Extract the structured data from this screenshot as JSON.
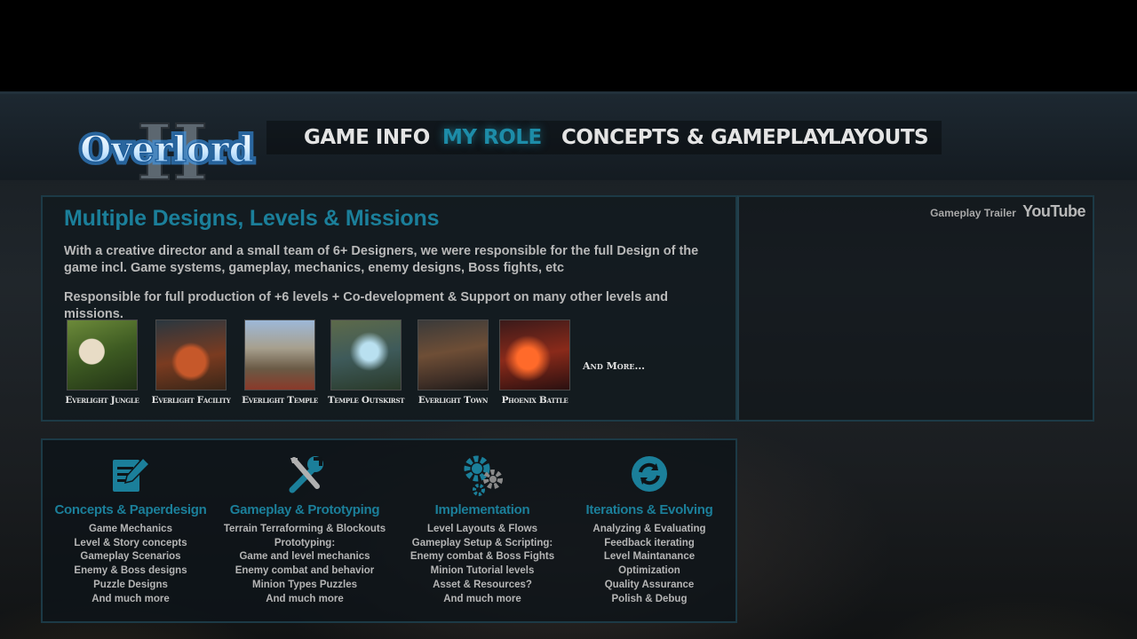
{
  "nav": {
    "items": [
      "GAME INFO",
      "MY ROLE",
      "CONCEPTS & GAMEPLAY",
      "LAYOUTS"
    ],
    "active": "MY ROLE"
  },
  "logo": {
    "text": "Overlord",
    "numeral": "II"
  },
  "main": {
    "title": "Multiple Designs, Levels & Missions",
    "paragraph1": "With a creative director and a small team of 6+ Designers, we were responsible for the full Design of the game incl. Game systems, gameplay, mechanics, enemy designs, Boss fights, etc",
    "paragraph2": "Responsible for full production of +6 levels + Co-development & Support on many other levels and missions.",
    "levels": [
      {
        "label": "Everlight Jungle"
      },
      {
        "label": "Everlight Facility"
      },
      {
        "label": "Everlight Temple"
      },
      {
        "label": "Temple Outskirst"
      },
      {
        "label": "Everlight Town"
      },
      {
        "label": "Phoenix Battle"
      }
    ],
    "and_more": "And More..."
  },
  "video": {
    "label": "Gameplay Trailer",
    "brand": "YouTube"
  },
  "roles": [
    {
      "icon": "document-edit-icon",
      "title": "Concepts & Paperdesign",
      "items": [
        "Game Mechanics",
        "Level & Story concepts",
        "Gameplay Scenarios",
        "Enemy & Boss designs",
        "Puzzle Designs",
        "And  much more"
      ]
    },
    {
      "icon": "tools-icon",
      "title": "Gameplay & Prototyping",
      "items": [
        "Terrain Terraforming & Blockouts",
        "Prototyping:",
        "Game and level mechanics",
        "Enemy combat and behavior",
        "Minion Types Puzzles",
        "And  much more"
      ]
    },
    {
      "icon": "gears-icon",
      "title": "Implementation",
      "items": [
        "Level Layouts & Flows",
        "Gameplay Setup & Scripting:",
        "Enemy combat & Boss Fights",
        "Minion Tutorial levels",
        "Asset & Resources?",
        "And  much more"
      ]
    },
    {
      "icon": "refresh-icon",
      "title": "Iterations & Evolving",
      "items": [
        "Analyzing & Evaluating",
        "Feedback iterating",
        "Level Maintanance",
        "Optimization",
        "Quality Assurance",
        "Polish & Debug"
      ]
    }
  ],
  "colors": {
    "accent": "#1b7f9a",
    "text": "#b9b9b9",
    "panel_border": "#1c3a46"
  }
}
